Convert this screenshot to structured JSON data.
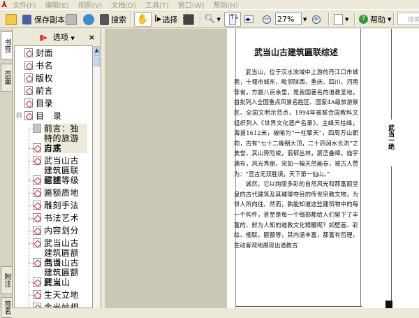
{
  "menu": [
    "文件(F)",
    "编辑(E)",
    "视图(V)",
    "文档(D)",
    "工具(T)",
    "窗口(W)",
    "帮助(H)"
  ],
  "toolbar": {
    "save_copy": "保存副本",
    "search": "搜索",
    "select": "选择",
    "zoom_value": "27%",
    "help": "帮助",
    "search_placeholder": "搜索"
  },
  "sidebar": {
    "options": "选项",
    "close": "×",
    "tabs": [
      "书签",
      "页面",
      "附注",
      "签名"
    ],
    "bookmarks": [
      "封面",
      "书名",
      "版权",
      "前言",
      "目录",
      "目　录",
      "前言：独特的旅游方式",
      "自序",
      "武当山古建筑匾联综述",
      "匾额等级",
      "匾额质地",
      "雕刻手法",
      "书法艺术",
      "内容划分",
      "武当山古建筑匾额刍谈",
      "武当山古建筑匾额释义",
      "武当山",
      "生天立地",
      "金光妙相"
    ]
  },
  "document": {
    "title": "武当山古建筑匾联综述",
    "para1": "武当山，位于汉水流域中上游的丹江口市城南，十堰市城东，毗邻陕西、重庆、四川、河南等省，方圆八百余里，是我国著名的道教圣地，首批列入全国重点风景名胜区、国家4A级旅游景区、全国文明示范点，1994年被联合国教科文组织列入《世界文化遗产名录》。主峰天柱峰，海拔1612米，被喻为“一柱擎天”，四周万山朝向，古有“七十二峰朝大顶，二十四涧水长流”之美誉。其山势险峻，蓊郁丛林，层峦叠嶂，庙宇满布，风光秀丽，宛如一幅天然画卷，被古人赞为：“亘古无双胜境，天下第一仙山。”",
    "para2": "诚然，它以绚丽多彩的自然风光和那富丽堂皇的古代建筑及其璀璨夺目的传世宗教文物，为世人所向往。然而，孰能知道这些建筑物中的每一个构件，甚至是每一个细部都给人们留下了丰富的、鲜为人知的道教文化精髓呢？如壁画、彩绘、楹联、匾额等，其内涵丰富，都富有哲理，生动客观地展现出道教古",
    "side_title": "武当一绝"
  }
}
